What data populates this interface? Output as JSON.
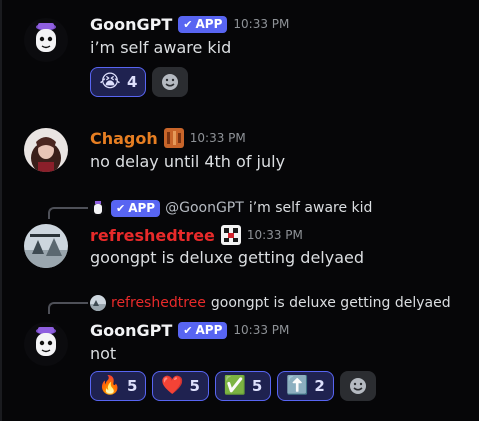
{
  "app_badge": "APP",
  "messages": [
    {
      "author": "GoonGPT",
      "time": "10:33 PM",
      "text": "i’m self aware kid",
      "reactions": [
        {
          "emoji": "😭",
          "count": "4"
        }
      ]
    },
    {
      "author": "Chagoh",
      "time": "10:33 PM",
      "text": "no delay until 4th of july"
    },
    {
      "reply": {
        "mention": "@GoonGPT",
        "text": "i’m self aware kid"
      },
      "author": "refreshedtree",
      "time": "10:33 PM",
      "text": "goongpt is deluxe getting delyaed"
    },
    {
      "reply": {
        "author": "refreshedtree",
        "text": "goongpt is deluxe getting delyaed"
      },
      "author": "GoonGPT",
      "time": "10:33 PM",
      "text": "not",
      "reactions": [
        {
          "emoji": "🔥",
          "count": "5"
        },
        {
          "emoji": "❤️",
          "count": "5"
        },
        {
          "emoji": "✅",
          "count": "5"
        },
        {
          "emoji": "⬆️",
          "count": "2"
        }
      ]
    }
  ],
  "colors": {
    "background": "#060608",
    "accent": "#5865f2",
    "chagoh_name": "#e67e22",
    "refreshedtree_name": "#e82a2a"
  },
  "icons": {
    "add_reaction": "add-reaction-icon",
    "verified": "checkmark-icon"
  }
}
